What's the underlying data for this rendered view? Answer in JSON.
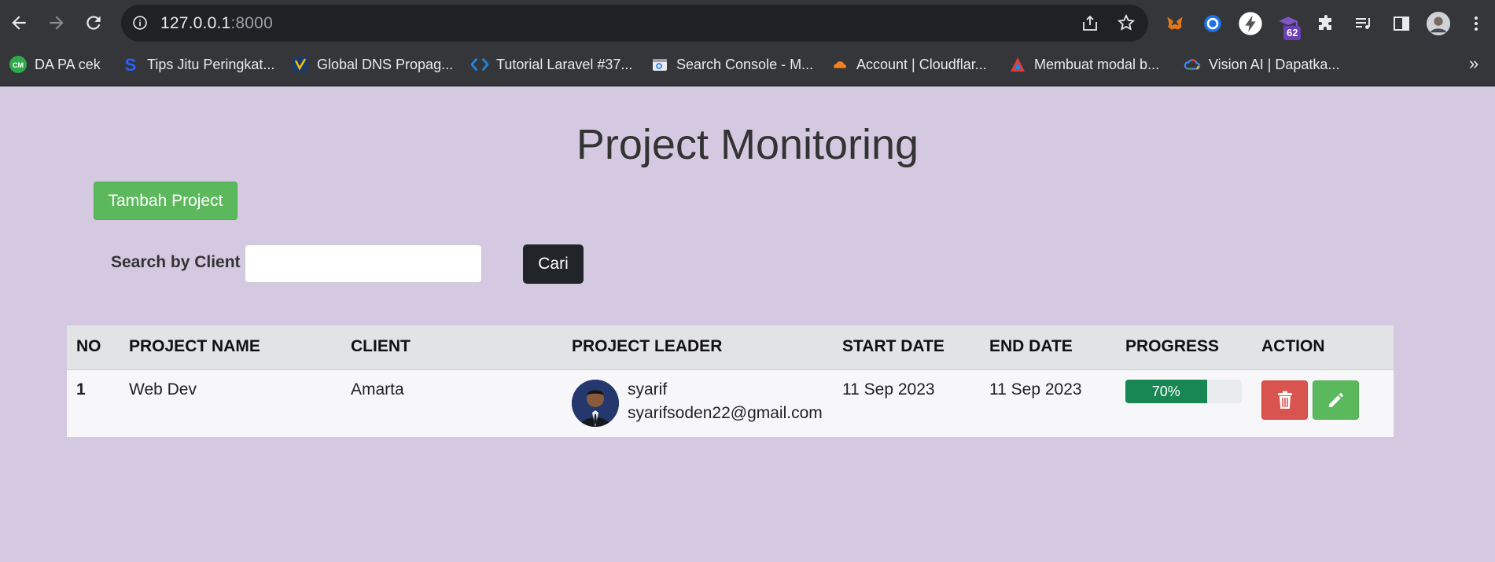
{
  "browser": {
    "url_host": "127.0.0.1",
    "url_port": ":8000",
    "extension_badge": "62",
    "bookmarks": [
      {
        "label": "DA PA cek",
        "icon": "cm-icon"
      },
      {
        "label": "Tips Jitu Peringkat...",
        "icon": "s-icon"
      },
      {
        "label": "Global DNS Propag...",
        "icon": "dns-icon"
      },
      {
        "label": "Tutorial Laravel #37...",
        "icon": "code-icon"
      },
      {
        "label": "Search Console - M...",
        "icon": "search-console-icon"
      },
      {
        "label": "Account | Cloudflar...",
        "icon": "cloudflare-icon"
      },
      {
        "label": "Membuat modal b...",
        "icon": "triangle-icon"
      },
      {
        "label": "Vision AI | Dapatka...",
        "icon": "google-cloud-icon"
      }
    ],
    "more_bookmarks": "»"
  },
  "page": {
    "title": "Project Monitoring",
    "add_button": "Tambah Project",
    "search_label": "Search by Client",
    "search_value": "",
    "search_button": "Cari"
  },
  "table": {
    "headers": [
      "NO",
      "PROJECT NAME",
      "CLIENT",
      "PROJECT LEADER",
      "START DATE",
      "END DATE",
      "PROGRESS",
      "ACTION"
    ],
    "rows": [
      {
        "no": "1",
        "project_name": "Web Dev",
        "client": "Amarta",
        "leader_name": "syarif",
        "leader_email": "syarifsoden22@gmail.com",
        "start_date": "11 Sep 2023",
        "end_date": "11 Sep 2023",
        "progress_label": "70%",
        "progress_fraction": 0.7
      }
    ]
  },
  "colors": {
    "page_bg": "#d4c9e1",
    "success": "#5cb85c",
    "danger": "#d9534f",
    "dark": "#212529",
    "progress": "#198754"
  }
}
